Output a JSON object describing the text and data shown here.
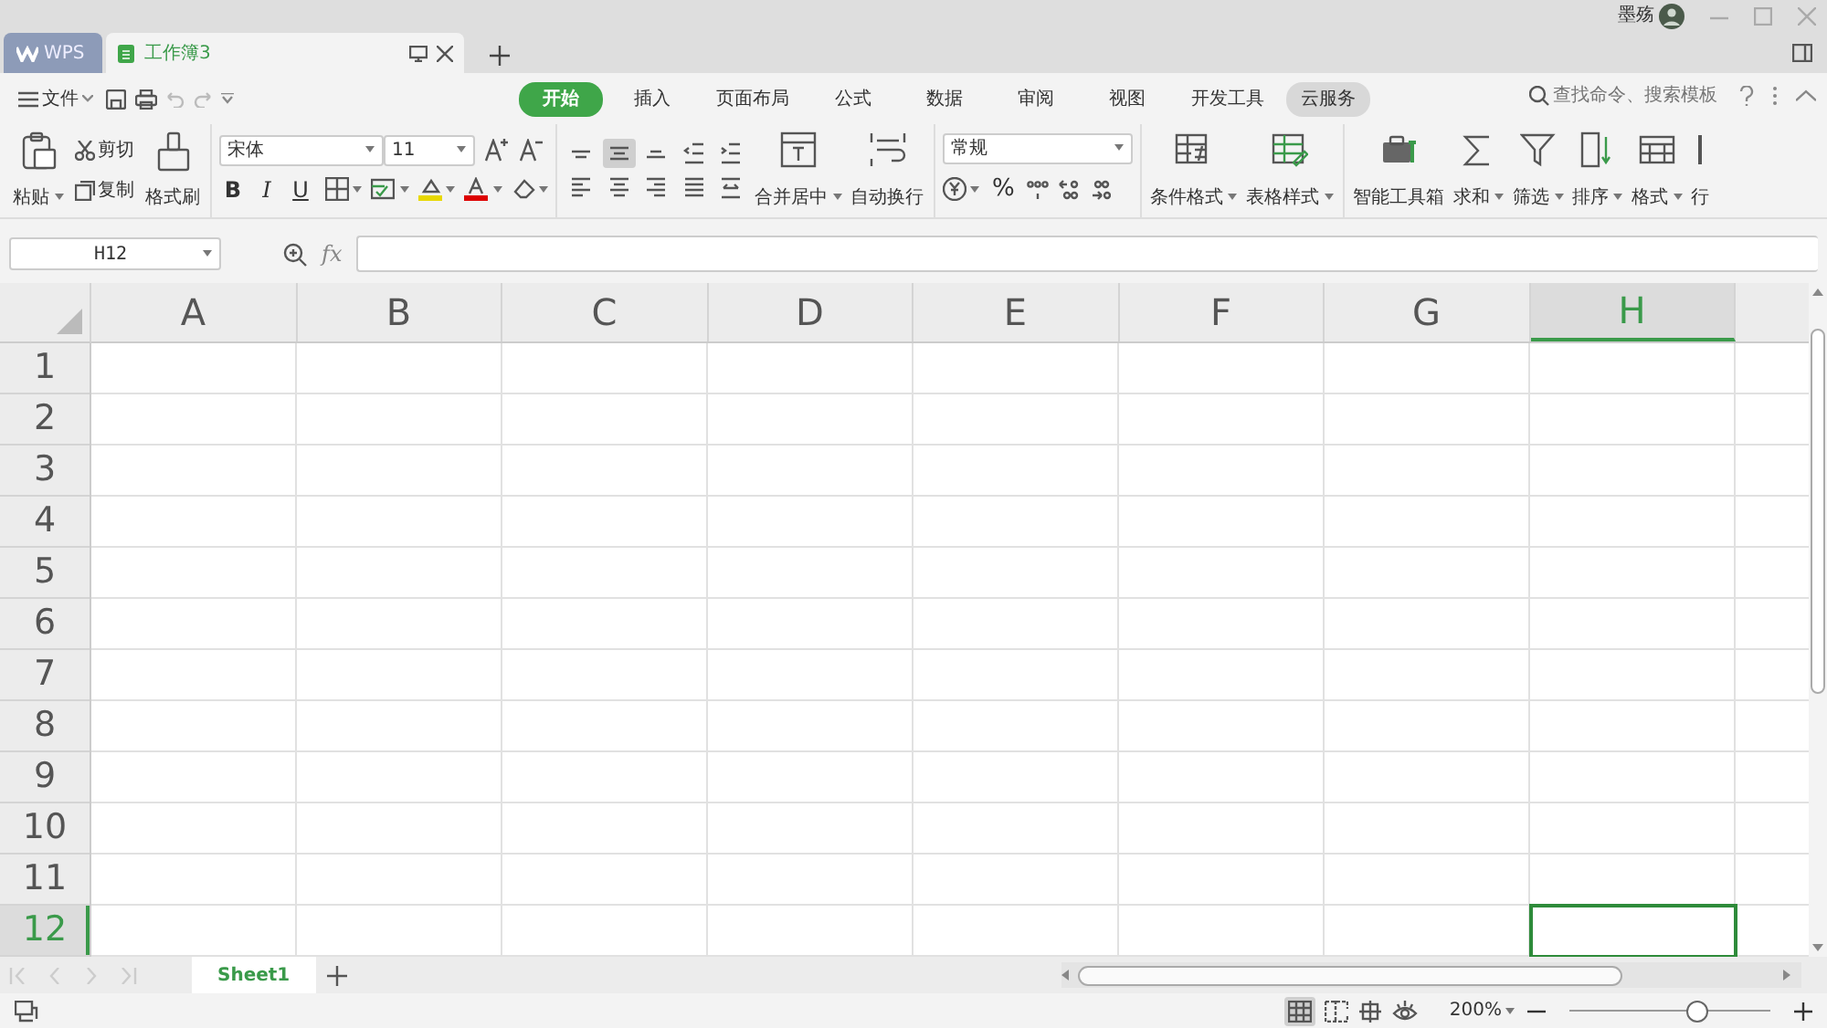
{
  "titlebar": {
    "app_tab": "WPS",
    "doc_tab": {
      "title": "工作簿3"
    },
    "user": "墨殇"
  },
  "menu": {
    "file": "文件",
    "tabs": [
      {
        "label": "开始",
        "selected": true,
        "hovered": false
      },
      {
        "label": "插入",
        "selected": false,
        "hovered": false
      },
      {
        "label": "页面布局",
        "selected": false,
        "hovered": false
      },
      {
        "label": "公式",
        "selected": false,
        "hovered": false
      },
      {
        "label": "数据",
        "selected": false,
        "hovered": false
      },
      {
        "label": "审阅",
        "selected": false,
        "hovered": false
      },
      {
        "label": "视图",
        "selected": false,
        "hovered": false
      },
      {
        "label": "开发工具",
        "selected": false,
        "hovered": false
      },
      {
        "label": "云服务",
        "selected": false,
        "hovered": true
      }
    ],
    "search": {
      "placeholder": "查找命令、搜索模板"
    }
  },
  "ribbon": {
    "paste": "粘贴",
    "cut": "剪切",
    "copy": "复制",
    "format_painter": "格式刷",
    "font": "宋体",
    "font_size": "11",
    "style_buttons": [
      "B",
      "I",
      "U"
    ],
    "align_buttons": [
      {
        "selected": false
      },
      {
        "selected": true
      },
      {
        "selected": false
      },
      {
        "selected": false
      },
      {
        "selected": false
      },
      {
        "selected": false
      },
      {
        "selected": false
      },
      {
        "selected": false
      },
      {
        "selected": false
      },
      {
        "selected": false
      }
    ],
    "merge": "合并居中",
    "wrap": "自动换行",
    "number_format": "常规",
    "percent": "%",
    "large_buttons": [
      {
        "label": "条件格式",
        "dropdown": true
      },
      {
        "label": "表格样式",
        "dropdown": true
      },
      {
        "label": "智能工具箱",
        "dropdown": false
      },
      {
        "label": "求和",
        "dropdown": true
      },
      {
        "label": "筛选",
        "dropdown": true
      },
      {
        "label": "排序",
        "dropdown": true
      },
      {
        "label": "格式",
        "dropdown": true
      },
      {
        "label": "行",
        "dropdown": false
      }
    ]
  },
  "formula_bar": {
    "name_box": "H12",
    "fx": "fx"
  },
  "grid": {
    "columns": [
      {
        "label": "A",
        "selected": false
      },
      {
        "label": "B",
        "selected": false
      },
      {
        "label": "C",
        "selected": false
      },
      {
        "label": "D",
        "selected": false
      },
      {
        "label": "E",
        "selected": false
      },
      {
        "label": "F",
        "selected": false
      },
      {
        "label": "G",
        "selected": false
      },
      {
        "label": "H",
        "selected": true
      }
    ],
    "rows": [
      {
        "label": "1",
        "selected": false
      },
      {
        "label": "2",
        "selected": false
      },
      {
        "label": "3",
        "selected": false
      },
      {
        "label": "4",
        "selected": false
      },
      {
        "label": "5",
        "selected": false
      },
      {
        "label": "6",
        "selected": false
      },
      {
        "label": "7",
        "selected": false
      },
      {
        "label": "8",
        "selected": false
      },
      {
        "label": "9",
        "selected": false
      },
      {
        "label": "10",
        "selected": false
      },
      {
        "label": "11",
        "selected": false
      },
      {
        "label": "12",
        "selected": true
      }
    ]
  },
  "sheets": [
    {
      "label": "Sheet1",
      "selected": true
    }
  ],
  "status_bar": {
    "zoom": "200%",
    "zoom_slider": {
      "level": 0.64
    }
  }
}
